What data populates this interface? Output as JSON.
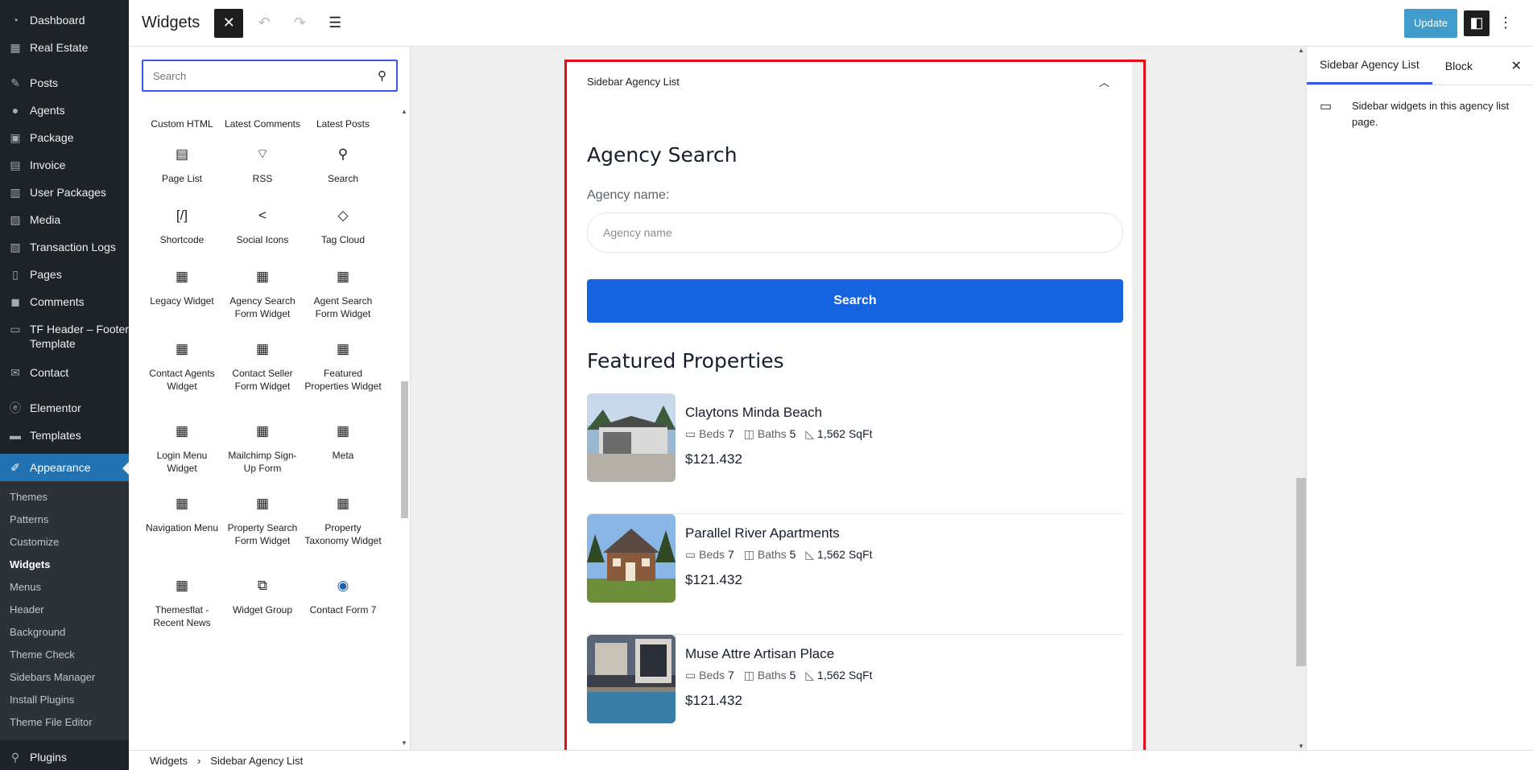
{
  "admin_menu": {
    "items": [
      {
        "label": "Dashboard",
        "icon": "dashboard-icon"
      },
      {
        "label": "Real Estate",
        "icon": "building-icon"
      },
      {
        "label": "Posts",
        "icon": "pin-icon"
      },
      {
        "label": "Agents",
        "icon": "users-icon"
      },
      {
        "label": "Package",
        "icon": "package-icon"
      },
      {
        "label": "Invoice",
        "icon": "invoice-icon"
      },
      {
        "label": "User Packages",
        "icon": "user-packages-icon"
      },
      {
        "label": "Media",
        "icon": "media-icon"
      },
      {
        "label": "Transaction Logs",
        "icon": "logs-icon"
      },
      {
        "label": "Pages",
        "icon": "pages-icon"
      },
      {
        "label": "Comments",
        "icon": "comments-icon"
      },
      {
        "label": "TF Header – Footer Template",
        "icon": "template-icon"
      },
      {
        "label": "Contact",
        "icon": "mail-icon"
      },
      {
        "label": "Elementor",
        "icon": "elementor-icon"
      },
      {
        "label": "Templates",
        "icon": "folder-icon"
      },
      {
        "label": "Appearance",
        "icon": "brush-icon"
      }
    ],
    "submenu": [
      "Themes",
      "Patterns",
      "Customize",
      "Widgets",
      "Menus",
      "Header",
      "Background",
      "Theme Check",
      "Sidebars Manager",
      "Install Plugins",
      "Theme File Editor"
    ],
    "after": {
      "label": "Plugins",
      "icon": "plugin-icon"
    }
  },
  "topbar": {
    "title": "Widgets",
    "update_label": "Update"
  },
  "inserter": {
    "search_placeholder": "Search",
    "blocks": [
      [
        "Custom HTML",
        "Latest Comments",
        "Latest Posts"
      ],
      [
        "Page List",
        "RSS",
        "Search"
      ],
      [
        "Shortcode",
        "Social Icons",
        "Tag Cloud"
      ],
      [
        "Legacy Widget",
        "Agency Search Form Widget",
        "Agent Search Form Widget"
      ],
      [
        "Contact Agents Widget",
        "Contact Seller Form Widget",
        "Featured Properties Widget"
      ],
      [
        "Login Menu Widget",
        "Mailchimp Sign-Up Form",
        "Meta"
      ],
      [
        "Navigation Menu",
        "Property Search Form Widget",
        "Property Taxonomy Widget"
      ],
      [
        "Themesflat - Recent News",
        "Widget Group",
        "Contact Form 7"
      ]
    ],
    "block_icons": [
      [
        "code-icon",
        "comment-icon",
        "list-icon"
      ],
      [
        "page-list-icon",
        "rss-icon",
        "search-icon"
      ],
      [
        "shortcode-icon",
        "share-icon",
        "tag-icon"
      ],
      [
        "calendar-icon",
        "calendar-icon",
        "calendar-icon"
      ],
      [
        "calendar-icon",
        "calendar-icon",
        "calendar-icon"
      ],
      [
        "calendar-icon",
        "calendar-icon",
        "calendar-icon"
      ],
      [
        "calendar-icon",
        "calendar-icon",
        "calendar-icon"
      ],
      [
        "calendar-icon",
        "group-icon",
        "contact-form-icon"
      ]
    ]
  },
  "widget_area": {
    "title": "Sidebar Agency List",
    "agency_heading": "Agency Search",
    "agency_label": "Agency name:",
    "agency_placeholder": "Agency name",
    "search_button": "Search",
    "featured_heading": "Featured Properties",
    "properties": [
      {
        "name": "Claytons Minda Beach",
        "beds_label": "Beds",
        "beds": "7",
        "baths_label": "Baths",
        "baths": "5",
        "area": "1,562 SqFt",
        "price": "$121.432"
      },
      {
        "name": "Parallel River Apartments",
        "beds_label": "Beds",
        "beds": "7",
        "baths_label": "Baths",
        "baths": "5",
        "area": "1,562 SqFt",
        "price": "$121.432"
      },
      {
        "name": "Muse Attre Artisan Place",
        "beds_label": "Beds",
        "beds": "7",
        "baths_label": "Baths",
        "baths": "5",
        "area": "1,562 SqFt",
        "price": "$121.432"
      }
    ]
  },
  "settings": {
    "tabs": [
      "Sidebar Agency List",
      "Block"
    ],
    "description": "Sidebar widgets in this agency list page."
  },
  "breadcrumb": [
    "Widgets",
    "Sidebar Agency List"
  ],
  "colors": {
    "accent": "#1563df",
    "wp_blue": "#2271b1",
    "highlight": "#e00e1a",
    "admin_bg": "#1d2327"
  }
}
